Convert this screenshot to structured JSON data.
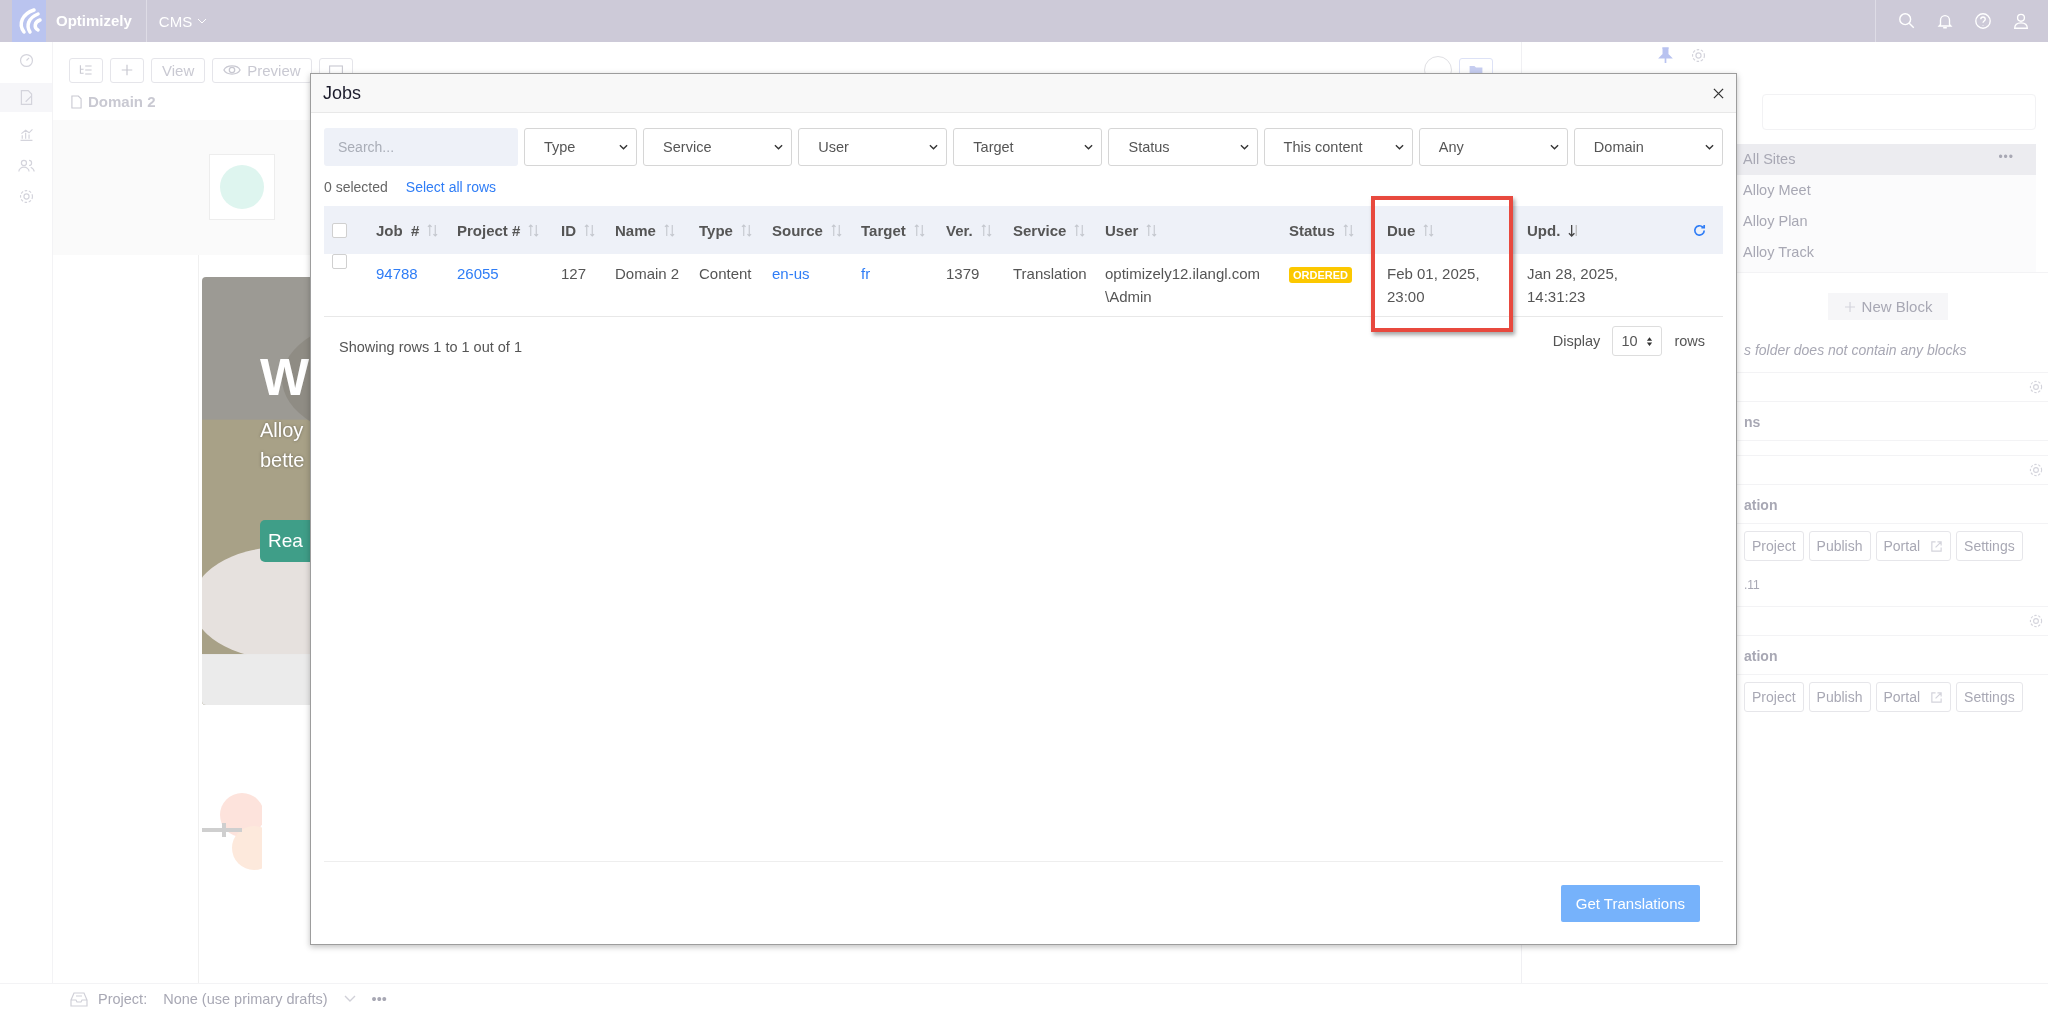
{
  "topbar": {
    "brand": "Optimizely",
    "app": "CMS"
  },
  "toolbar": {
    "buttons": [
      {
        "label": "View",
        "kind": "text"
      },
      {
        "label": "Preview",
        "kind": "eye"
      }
    ]
  },
  "page": {
    "title": "Domain 2"
  },
  "hero": {
    "heading": "W",
    "lines": [
      "Alloy",
      "bette"
    ],
    "button": "Rea"
  },
  "right_panel": {
    "items": [
      {
        "label": "All Sites",
        "selected": true
      },
      {
        "label": "Alloy Meet",
        "selected": false
      },
      {
        "label": "Alloy Plan",
        "selected": false
      },
      {
        "label": "Alloy Track",
        "selected": false
      }
    ],
    "more": "•••",
    "new_block": "New Block",
    "empty_note": "s folder does not contain any blocks",
    "sections": [
      {
        "title": "ns"
      },
      {
        "title": "ation",
        "buttons": [
          {
            "label": "Project",
            "external": false
          },
          {
            "label": "Publish",
            "external": false
          },
          {
            "label": "Portal",
            "external": true
          },
          {
            "label": "Settings",
            "external": false
          }
        ],
        "note": ".11"
      },
      {
        "title": "ation",
        "buttons": [
          {
            "label": "Project",
            "external": false
          },
          {
            "label": "Publish",
            "external": false
          },
          {
            "label": "Portal",
            "external": true
          },
          {
            "label": "Settings",
            "external": false
          }
        ]
      }
    ]
  },
  "bottom_bar": {
    "label": "Project:",
    "value": "None (use primary drafts)",
    "more": "•••"
  },
  "modal": {
    "title": "Jobs",
    "search": {
      "placeholder": "Search..."
    },
    "filters": [
      "Type",
      "Service",
      "User",
      "Target",
      "Status",
      "This content",
      "Any",
      "Domain"
    ],
    "selection": {
      "count": "0 selected",
      "select_all": "Select all rows"
    },
    "table": {
      "select_all_checked": false,
      "columns": [
        {
          "label": "Job  #",
          "sorted": false,
          "highlighted": false
        },
        {
          "label": "Project #",
          "sorted": false,
          "highlighted": false
        },
        {
          "label": "ID",
          "sorted": false,
          "highlighted": false
        },
        {
          "label": "Name",
          "sorted": false,
          "highlighted": false
        },
        {
          "label": "Type",
          "sorted": false,
          "highlighted": false
        },
        {
          "label": "Source",
          "sorted": false,
          "highlighted": false
        },
        {
          "label": "Target",
          "sorted": false,
          "highlighted": false
        },
        {
          "label": "Ver.",
          "sorted": false,
          "highlighted": false
        },
        {
          "label": "Service",
          "sorted": false,
          "highlighted": false
        },
        {
          "label": "User",
          "sorted": false,
          "highlighted": false
        },
        {
          "label": "Status",
          "sorted": false,
          "highlighted": false
        },
        {
          "label": "Due",
          "sorted": false,
          "highlighted": true
        },
        {
          "label": "Upd.",
          "sorted": true,
          "highlighted": false
        }
      ],
      "rows": [
        {
          "checked": false,
          "cells": [
            {
              "text": "94788",
              "kind": "link"
            },
            {
              "text": "26055",
              "kind": "link"
            },
            {
              "text": "127",
              "kind": "text"
            },
            {
              "text": "Domain 2",
              "kind": "text"
            },
            {
              "text": "Content",
              "kind": "text"
            },
            {
              "text": "en-us",
              "kind": "link"
            },
            {
              "text": "fr",
              "kind": "link"
            },
            {
              "text": "1379",
              "kind": "text"
            },
            {
              "text": "Translation",
              "kind": "text"
            },
            {
              "text": "optimizely12.ilangl.com\\Admin",
              "kind": "text"
            },
            {
              "text": "ORDERED",
              "kind": "badge"
            },
            {
              "text": "Feb 01, 2025, 23:00",
              "kind": "text"
            },
            {
              "text": "Jan 28, 2025, 14:31:23",
              "kind": "text"
            }
          ]
        }
      ]
    },
    "pagination": {
      "summary": "Showing rows 1 to 1 out of 1",
      "display": "Display",
      "page_size": "10",
      "rows": "rows"
    },
    "primary_button": "Get Translations"
  }
}
